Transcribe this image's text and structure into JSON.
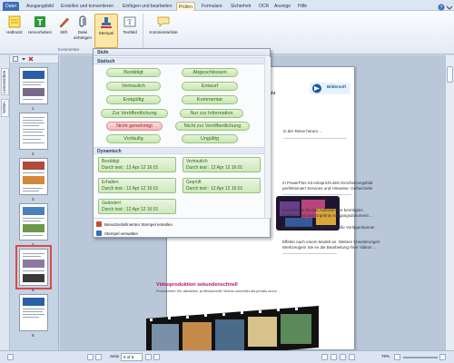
{
  "tabs": [
    "Datei",
    "Ausgangsbild",
    "Erstellen und konvertieren",
    "Einfügen und bearbeiten",
    "Prüfen",
    "Formulare",
    "Sicherheit",
    "OCR",
    "Anzeige",
    "Hilfe"
  ],
  "ribbon": {
    "buttons": [
      "Haftnotiz",
      "Hervorheben",
      "Stift",
      "Datei anhängen",
      "Stempel",
      "Textfeld",
      "Kommentarliste"
    ],
    "group_label": "Kommentar"
  },
  "left_tabs": [
    "Lesezeichen",
    "Seiten"
  ],
  "thumbnails": [
    "1",
    "2",
    "3",
    "4",
    "5",
    "6"
  ],
  "dropdown": {
    "title": "Stufe",
    "static_header": "Statisch",
    "static_stamps": [
      {
        "label": "Bestätigt",
        "color": "#c9e6b3"
      },
      {
        "label": "Abgeschlossen",
        "color": "#c9e6b3"
      },
      {
        "label": "Vertraulich",
        "color": "#c9e6b3"
      },
      {
        "label": "Entwurf",
        "color": "#c9e6b3"
      },
      {
        "label": "Endgültig",
        "color": "#c9e6b3"
      },
      {
        "label": "Kommentar",
        "color": "#c9e6b3"
      },
      {
        "label": "Zur Veröffentlichung",
        "color": "#c9e6b3"
      },
      {
        "label": "Nur zur Information",
        "color": "#c9e6b3"
      },
      {
        "label": "Nicht genehmigt",
        "color": "#f3b8b8"
      },
      {
        "label": "Nicht zur Veröffentlichung",
        "color": "#c9e6b3"
      },
      {
        "label": "Vorläufig",
        "color": "#c9e6b3"
      },
      {
        "label": "Ungültig",
        "color": "#c9e6b3"
      }
    ],
    "dynamic_header": "Dynamisch",
    "dynamic_stamps": [
      {
        "title": "Bestätigt",
        "by": "Durch test : 12 Apr 12 16:01"
      },
      {
        "title": "Vertraulich",
        "by": "Durch test : 12 Apr 12 16:01"
      },
      {
        "title": "Erhalten",
        "by": "Durch test : 12 Apr 12 16:01"
      },
      {
        "title": "Geprüft",
        "by": "Durch test : 12 Apr 12 16:01"
      },
      {
        "title": "Geändert",
        "by": "Durch test : 12 Apr 12 16:01"
      }
    ],
    "actions": [
      "Benutzerdefinierten Stempel erstellen",
      "Stempel verwalten"
    ]
  },
  "document": {
    "logo_name": "Bildersoft",
    "frag_header": "macht",
    "frag_intro": "in der Reise herum ...",
    "frag_1": "m PowerPlus Kit entspricht dem Erscheinungsbild",
    "frag_2": "perfektioniert Services und Hinweise. Gefaschelte",
    "frag_3": "und weniger für das Auftreten der benötigten",
    "frag_4": "Software und das Ergebnis Ausgangsdokument ...",
    "frag_5": "navigieren, ob sie in der 2D/Größe Vorlagenbanner",
    "frag_6": "Effekte nach einem Modell an. Weitere Erweiterungen",
    "frag_7": "Werkzeugen! Sie es die Bearbeitung Ihrer Videos ...",
    "section_heading": "Videoproduktion sekundenschnell",
    "section_text": "Produzieren Sie attraktive, professionelle Videos schneller als jemals zuvor ..."
  },
  "status": {
    "page_label": "Seite",
    "page_value": "5 of 6",
    "zoom": "78%"
  },
  "colors": {
    "accent": "#3b6fb6",
    "stamp_green": "#c9e6b3",
    "stamp_red": "#f3b8b8",
    "thumb_selected": "#d94a4a"
  }
}
